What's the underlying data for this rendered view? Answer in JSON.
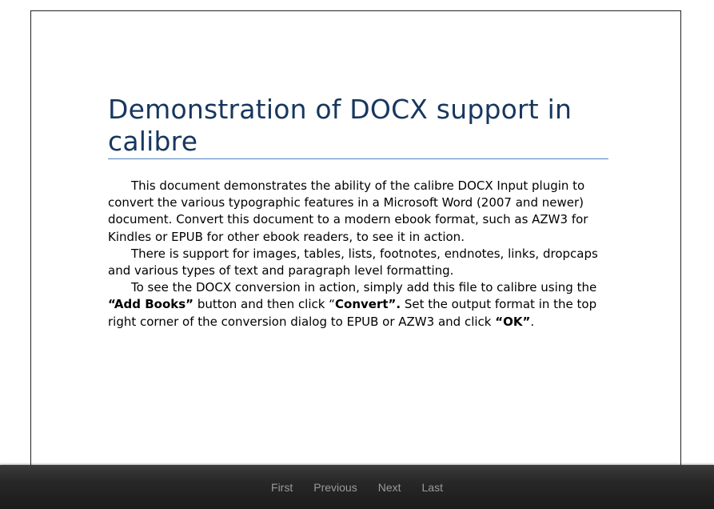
{
  "document": {
    "title": "Demonstration of DOCX support in calibre",
    "paragraphs": [
      {
        "segments": [
          {
            "text": "This document demonstrates the ability of the calibre DOCX Input plugin to convert the various typographic features in a Microsoft Word (2007 and newer) document. Convert this document to a modern ebook format, such as AZW3 for Kindles or EPUB for other ebook readers, to see it in action.",
            "bold": false
          }
        ]
      },
      {
        "segments": [
          {
            "text": "There is support for images, tables, lists, footnotes, endnotes, links, dropcaps and various types of text and paragraph level formatting.",
            "bold": false
          }
        ]
      },
      {
        "segments": [
          {
            "text": "To see the DOCX conversion in action, simply add this file to calibre using the ",
            "bold": false
          },
          {
            "text": "“Add Books”",
            "bold": true
          },
          {
            "text": " button and then click “",
            "bold": false
          },
          {
            "text": "Convert”.",
            "bold": true
          },
          {
            "text": "  Set the output format in the top right corner of the conversion dialog to EPUB or AZW3 and click ",
            "bold": false
          },
          {
            "text": "“OK”",
            "bold": true
          },
          {
            "text": ".",
            "bold": false
          }
        ]
      }
    ]
  },
  "navigation": {
    "first_label": "First",
    "previous_label": "Previous",
    "next_label": "Next",
    "last_label": "Last"
  },
  "colors": {
    "title": "#17375e",
    "title_rule": "#4f81bd",
    "nav_bar": "#272727",
    "nav_link": "#9a9a9a"
  }
}
